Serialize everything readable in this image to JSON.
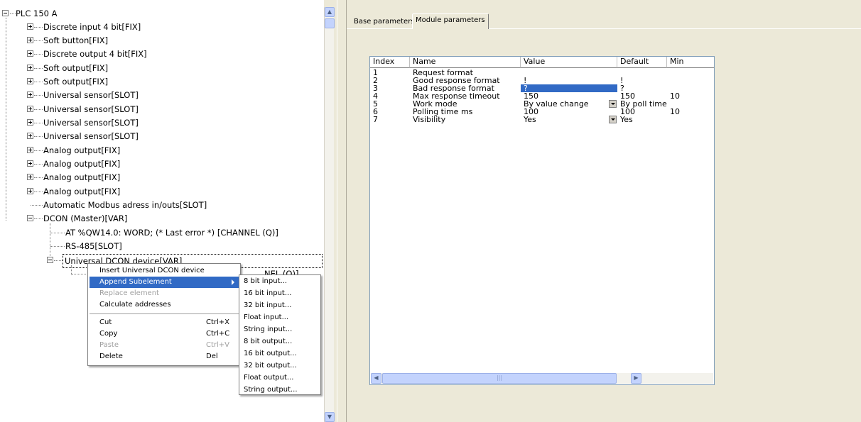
{
  "tree": {
    "root": "PLC 150 A",
    "children": [
      "Discrete input 4 bit[FIX]",
      "Soft button[FIX]",
      "Discrete output 4 bit[FIX]",
      "Soft output[FIX]",
      "Soft output[FIX]",
      "Universal sensor[SLOT]",
      "Universal sensor[SLOT]",
      "Universal sensor[SLOT]",
      "Universal sensor[SLOT]",
      "Analog output[FIX]",
      "Analog output[FIX]",
      "Analog output[FIX]",
      "Analog output[FIX]",
      "Automatic Modbus adress in/outs[SLOT]",
      "DCON (Master)[VAR]"
    ],
    "dcon_children": [
      "AT %QW14.0: WORD; (* Last error *) [CHANNEL (Q)]",
      "RS-485[SLOT]",
      "Universal DCON device[VAR]"
    ],
    "partial_label": "NEL (Q)]"
  },
  "tabs": {
    "base": "Base parameters",
    "module": "Module parameters"
  },
  "grid": {
    "columns": [
      "Index",
      "Name",
      "Value",
      "Default",
      "Min"
    ],
    "rows": [
      {
        "index": "1",
        "name": "Request format",
        "value": "",
        "default": "",
        "min": ""
      },
      {
        "index": "2",
        "name": "Good response format",
        "value": "!",
        "default": "!",
        "min": ""
      },
      {
        "index": "3",
        "name": "Bad response format",
        "value": "?",
        "default": "?",
        "min": ""
      },
      {
        "index": "4",
        "name": "Max response timeout",
        "value": "150",
        "default": "150",
        "min": "10"
      },
      {
        "index": "5",
        "name": "Work mode",
        "value": "By value change",
        "default": "By poll time",
        "min": ""
      },
      {
        "index": "6",
        "name": "Polling time ms",
        "value": "100",
        "default": "100",
        "min": "10"
      },
      {
        "index": "7",
        "name": "Visibility",
        "value": "Yes",
        "default": "Yes",
        "min": ""
      }
    ]
  },
  "context_menu": {
    "items": [
      {
        "label": "Insert Universal DCON device",
        "shortcut": ""
      },
      {
        "label": "Append Subelement",
        "shortcut": ""
      },
      {
        "label": "Replace element",
        "shortcut": ""
      },
      {
        "label": "Calculate addresses",
        "shortcut": ""
      },
      {
        "label": "Cut",
        "shortcut": "Ctrl+X"
      },
      {
        "label": "Copy",
        "shortcut": "Ctrl+C"
      },
      {
        "label": "Paste",
        "shortcut": "Ctrl+V"
      },
      {
        "label": "Delete",
        "shortcut": "Del"
      }
    ]
  },
  "submenu": {
    "items": [
      "8 bit input...",
      "16 bit input...",
      "32 bit input...",
      "Float input...",
      "String input...",
      "8 bit output...",
      "16 bit output...",
      "32 bit output...",
      "Float output...",
      "String output..."
    ]
  },
  "colors": {
    "selection": "#316ac5",
    "panel": "#ece9d8",
    "scroll_thumb": "#c3d3fd"
  }
}
